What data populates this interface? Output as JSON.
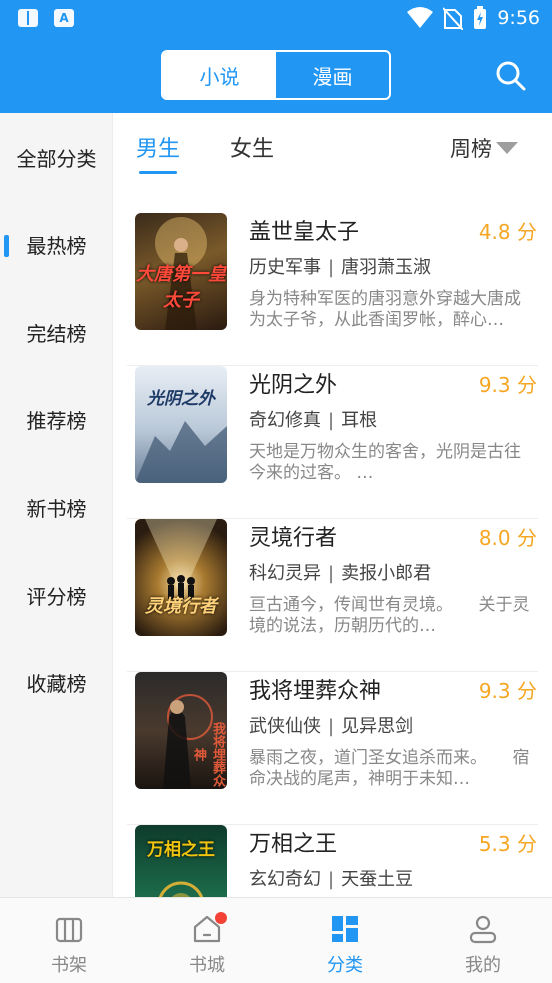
{
  "status_bar": {
    "time": "9:56"
  },
  "header": {
    "segments": [
      {
        "label": "小说",
        "active": true
      },
      {
        "label": "漫画",
        "active": false
      }
    ]
  },
  "sidebar": {
    "items": [
      {
        "label": "全部分类",
        "active": false
      },
      {
        "label": "最热榜",
        "active": true
      },
      {
        "label": "完结榜",
        "active": false
      },
      {
        "label": "推荐榜",
        "active": false
      },
      {
        "label": "新书榜",
        "active": false
      },
      {
        "label": "评分榜",
        "active": false
      },
      {
        "label": "收藏榜",
        "active": false
      }
    ]
  },
  "content": {
    "gender_tabs": [
      {
        "label": "男生",
        "active": true
      },
      {
        "label": "女生",
        "active": false
      }
    ],
    "period": "周榜",
    "books": [
      {
        "title": "盖世皇太子",
        "score": "4.8 分",
        "category": "历史军事",
        "author": "唐羽萧玉淑",
        "desc": "身为特种军医的唐羽意外穿越大唐成为太子爷，从此香闺罗帐，醉心…",
        "cover_text": "大唐第一皇太子"
      },
      {
        "title": "光阴之外",
        "score": "9.3 分",
        "category": "奇幻修真",
        "author": "耳根",
        "desc": "天地是万物众生的客舍，光阴是古往今来的过客。 …",
        "cover_text": "光阴之外"
      },
      {
        "title": "灵境行者",
        "score": "8.0 分",
        "category": "科幻灵异",
        "author": "卖报小郎君",
        "desc": "亘古通今，传闻世有灵境。　　关于灵境的说法，历朝历代的…",
        "cover_text": "灵境行者"
      },
      {
        "title": "我将埋葬众神",
        "score": "9.3 分",
        "category": "武侠仙侠",
        "author": "见异思剑",
        "desc": "暴雨之夜，道门圣女追杀而来。　　宿命决战的尾声，神明于未知…",
        "cover_text": "我将埋葬众神"
      },
      {
        "title": "万相之王",
        "score": "5.3 分",
        "category": "玄幻奇幻",
        "author": "天蚕土豆",
        "desc": "",
        "cover_text": "万相之王"
      }
    ]
  },
  "bottom_nav": {
    "items": [
      {
        "label": "书架",
        "icon": "bookshelf-icon",
        "active": false
      },
      {
        "label": "书城",
        "icon": "store-icon",
        "active": false,
        "badge": true
      },
      {
        "label": "分类",
        "icon": "category-icon",
        "active": true
      },
      {
        "label": "我的",
        "icon": "profile-icon",
        "active": false
      }
    ]
  },
  "colors": {
    "primary": "#2196F3",
    "score": "#F5A623",
    "badge": "#f44336"
  }
}
